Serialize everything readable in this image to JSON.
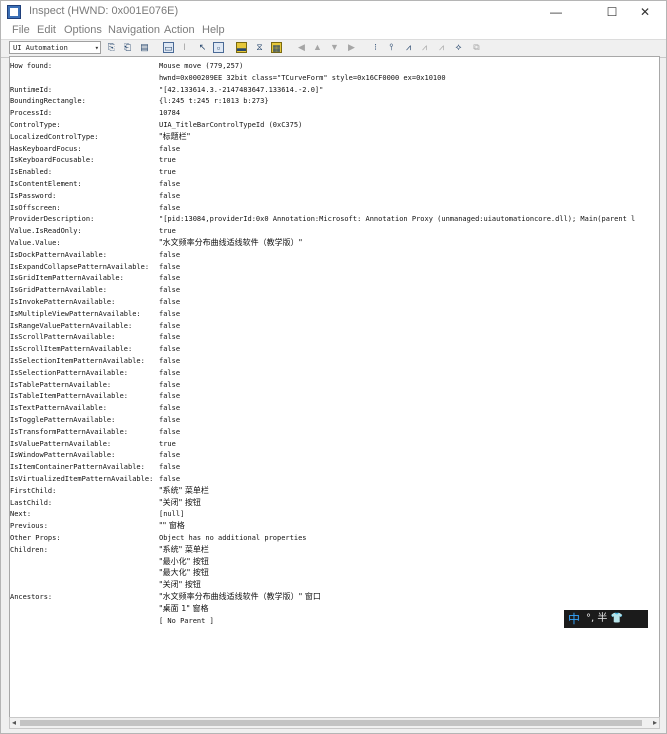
{
  "window": {
    "title": "Inspect  (HWND: 0x001E076E)",
    "buttons": {
      "minimize": "—",
      "maximize": "☐",
      "close": "✕"
    }
  },
  "menu": [
    "File",
    "Edit",
    "Options",
    "Navigation",
    "Action",
    "Help"
  ],
  "toolbar": {
    "mode": "UI Automation",
    "dropdown_arrow": "▾",
    "icons": [
      "copy-icon",
      "paste-icon",
      "options-icon",
      "highlight-rect-icon",
      "caret-icon",
      "pointer-icon",
      "focus-icon",
      "window-icon",
      "expand-icon",
      "collapse-icon",
      "nav-back-icon",
      "nav-up-icon",
      "nav-down-icon",
      "nav-forward-icon",
      "tree-parent-icon",
      "tree-first-child-icon",
      "tree-prev-icon",
      "tree-next-icon",
      "tree-last-child-icon",
      "tree-child-icon",
      "refresh-icon"
    ],
    "glyphs": [
      "⎘",
      "⎗",
      "▤",
      "▭",
      "I",
      "↖",
      "▫",
      "▬",
      "⧖",
      "▦",
      "◀",
      "▲",
      "▼",
      "▶",
      "⁝",
      "⫯",
      "⩘",
      "⩘",
      "⩘",
      "⟡",
      "⧉"
    ]
  },
  "properties": [
    {
      "key": "How found:",
      "value": "Mouse move (779,257)"
    },
    {
      "key": "",
      "value": "hwnd=0x000209EE 32bit class=\"TCurveForm\" style=0x16CF0000 ex=0x10100"
    },
    {
      "key": "RuntimeId:",
      "value": "\"[42.133614.3.-2147483647.133614.-2.0]\""
    },
    {
      "key": "BoundingRectangle:",
      "value": "{l:245 t:245 r:1013 b:273}"
    },
    {
      "key": "ProcessId:",
      "value": "10784"
    },
    {
      "key": "ControlType:",
      "value": "UIA_TitleBarControlTypeId (0xC375)"
    },
    {
      "key": "LocalizedControlType:",
      "value": "\"标题栏\""
    },
    {
      "key": "HasKeyboardFocus:",
      "value": "false"
    },
    {
      "key": "IsKeyboardFocusable:",
      "value": "true"
    },
    {
      "key": "IsEnabled:",
      "value": "true"
    },
    {
      "key": "IsContentElement:",
      "value": "false"
    },
    {
      "key": "IsPassword:",
      "value": "false"
    },
    {
      "key": "IsOffscreen:",
      "value": "false"
    },
    {
      "key": "ProviderDescription:",
      "value": "\"[pid:13084,providerId:0x0 Annotation:Microsoft: Annotation Proxy (unmanaged:uiautomationcore.dll); Main(parent l"
    },
    {
      "key": "Value.IsReadOnly:",
      "value": "true"
    },
    {
      "key": "Value.Value:",
      "value": "\"水文频率分布曲线适线软件（教学版）\""
    },
    {
      "key": "IsDockPatternAvailable:",
      "value": "false"
    },
    {
      "key": "IsExpandCollapsePatternAvailable:",
      "value": "false"
    },
    {
      "key": "IsGridItemPatternAvailable:",
      "value": "false"
    },
    {
      "key": "IsGridPatternAvailable:",
      "value": "false"
    },
    {
      "key": "IsInvokePatternAvailable:",
      "value": "false"
    },
    {
      "key": "IsMultipleViewPatternAvailable:",
      "value": "false"
    },
    {
      "key": "IsRangeValuePatternAvailable:",
      "value": "false"
    },
    {
      "key": "IsScrollPatternAvailable:",
      "value": "false"
    },
    {
      "key": "IsScrollItemPatternAvailable:",
      "value": "false"
    },
    {
      "key": "IsSelectionItemPatternAvailable:",
      "value": "false"
    },
    {
      "key": "IsSelectionPatternAvailable:",
      "value": "false"
    },
    {
      "key": "IsTablePatternAvailable:",
      "value": "false"
    },
    {
      "key": "IsTableItemPatternAvailable:",
      "value": "false"
    },
    {
      "key": "IsTextPatternAvailable:",
      "value": "false"
    },
    {
      "key": "IsTogglePatternAvailable:",
      "value": "false"
    },
    {
      "key": "IsTransformPatternAvailable:",
      "value": "false"
    },
    {
      "key": "IsValuePatternAvailable:",
      "value": "true"
    },
    {
      "key": "IsWindowPatternAvailable:",
      "value": "false"
    },
    {
      "key": "IsItemContainerPatternAvailable:",
      "value": "false"
    },
    {
      "key": "IsVirtualizedItemPatternAvailable:",
      "value": "      false"
    },
    {
      "key": "FirstChild:",
      "value": "\"系统\" 菜单栏"
    },
    {
      "key": "LastChild:",
      "value": "\"关闭\" 按钮"
    },
    {
      "key": "Next:",
      "value": "[null]"
    },
    {
      "key": "Previous:",
      "value": "\"\" 窗格"
    },
    {
      "key": "Other Props:",
      "value": "Object has no additional properties"
    },
    {
      "key": "Children:",
      "value": "\"系统\" 菜单栏"
    },
    {
      "key": "",
      "value": "\"最小化\" 按钮"
    },
    {
      "key": "",
      "value": "\"最大化\" 按钮"
    },
    {
      "key": "",
      "value": "\"关闭\" 按钮"
    },
    {
      "key": "Ancestors:",
      "value": "\"水文频率分布曲线适线软件（教学版）\" 窗口"
    },
    {
      "key": "",
      "value": "\"桌面 1\" 窗格"
    },
    {
      "key": "",
      "value": "[ No Parent ]"
    }
  ],
  "scrollbar": {
    "left": "◂",
    "right": "▸"
  },
  "ime": {
    "lang": "中",
    "rest": "°, 半 👕"
  }
}
